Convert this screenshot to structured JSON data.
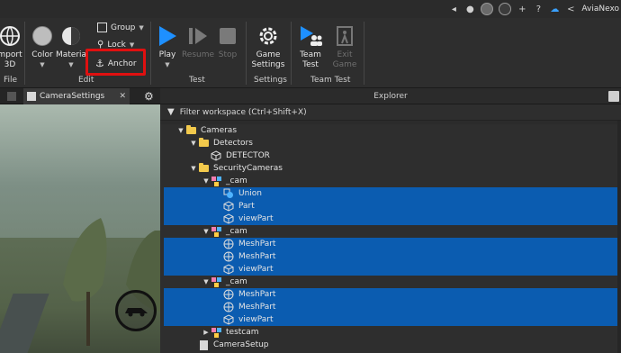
{
  "top": {
    "username": "AviaNexo"
  },
  "ribbon": {
    "import_label": "mport\n3D",
    "color_label": "Color",
    "material_label": "Materia",
    "group_label": "Group",
    "lock_label": "Lock",
    "anchor_label": "Anchor",
    "play_label": "Play",
    "resume_label": "Resume",
    "stop_label": "Stop",
    "game_settings_label": "Game\nSettings",
    "team_test_label": "Team\nTest",
    "exit_game_label": "Exit\nGame",
    "groups": {
      "file": "File",
      "edit": "Edit",
      "test": "Test",
      "settings": "Settings",
      "team_test": "Team Test"
    },
    "accent_color": "#1e90ff",
    "highlight_color": "#e01010"
  },
  "tabs": {
    "active": "CameraSettings"
  },
  "explorer": {
    "title": "Explorer",
    "filter_placeholder": "Filter workspace (Ctrl+Shift+X)",
    "selection_color": "#0b5cb0",
    "items": [
      {
        "label": "Cameras",
        "icon": "folder-icon",
        "depth": 0,
        "expanded": true,
        "selected": false
      },
      {
        "label": "Detectors",
        "icon": "folder-icon",
        "depth": 1,
        "expanded": true,
        "selected": false
      },
      {
        "label": "DETECTOR",
        "icon": "part-icon",
        "depth": 2,
        "expanded": null,
        "selected": false
      },
      {
        "label": "SecurityCameras",
        "icon": "folder-icon",
        "depth": 1,
        "expanded": true,
        "selected": false
      },
      {
        "label": "_cam",
        "icon": "model-icon",
        "depth": 2,
        "expanded": true,
        "selected": false
      },
      {
        "label": "Union",
        "icon": "union-icon",
        "depth": 3,
        "expanded": null,
        "selected": true
      },
      {
        "label": "Part",
        "icon": "part-icon",
        "depth": 3,
        "expanded": null,
        "selected": true
      },
      {
        "label": "viewPart",
        "icon": "part-icon",
        "depth": 3,
        "expanded": null,
        "selected": true
      },
      {
        "label": "_cam",
        "icon": "model-icon",
        "depth": 2,
        "expanded": true,
        "selected": false
      },
      {
        "label": "MeshPart",
        "icon": "meshpart-icon",
        "depth": 3,
        "expanded": null,
        "selected": true
      },
      {
        "label": "MeshPart",
        "icon": "meshpart-icon",
        "depth": 3,
        "expanded": null,
        "selected": true
      },
      {
        "label": "viewPart",
        "icon": "part-icon",
        "depth": 3,
        "expanded": null,
        "selected": true
      },
      {
        "label": "_cam",
        "icon": "model-icon",
        "depth": 2,
        "expanded": true,
        "selected": false
      },
      {
        "label": "MeshPart",
        "icon": "meshpart-icon",
        "depth": 3,
        "expanded": null,
        "selected": true
      },
      {
        "label": "MeshPart",
        "icon": "meshpart-icon",
        "depth": 3,
        "expanded": null,
        "selected": true
      },
      {
        "label": "viewPart",
        "icon": "part-icon",
        "depth": 3,
        "expanded": null,
        "selected": true
      },
      {
        "label": "testcam",
        "icon": "model-icon",
        "depth": 2,
        "expanded": false,
        "selected": false
      },
      {
        "label": "CameraSetup",
        "icon": "script-icon",
        "depth": 1,
        "expanded": null,
        "selected": false
      }
    ]
  }
}
